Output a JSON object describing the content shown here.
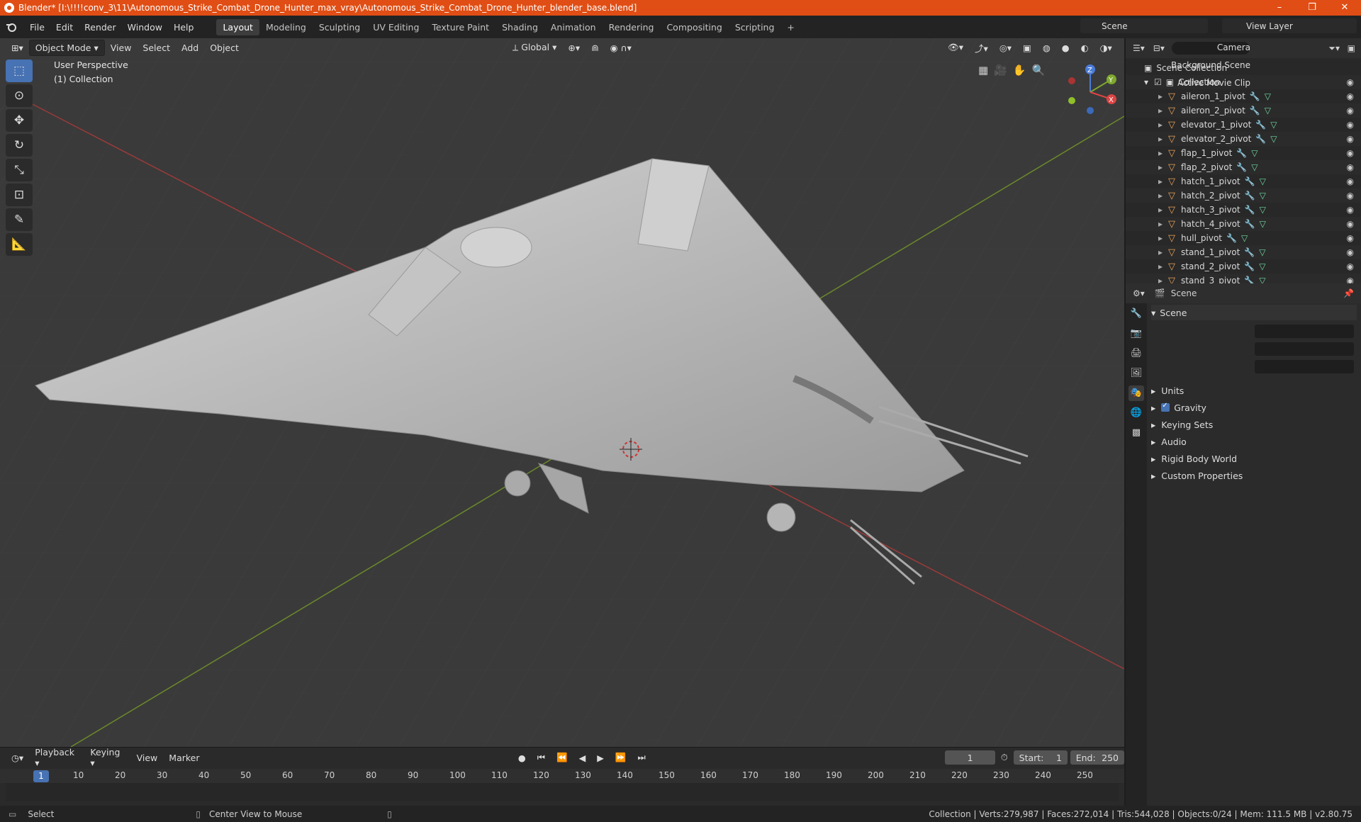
{
  "window": {
    "title": "Blender* [I:\\!!!!conv_3\\11\\Autonomous_Strike_Combat_Drone_Hunter_max_vray\\Autonomous_Strike_Combat_Drone_Hunter_blender_base.blend]",
    "controls": [
      "–",
      "❐",
      "✕"
    ]
  },
  "menubar": {
    "menus": [
      "File",
      "Edit",
      "Render",
      "Window",
      "Help"
    ],
    "workspaces": [
      "Layout",
      "Modeling",
      "Sculpting",
      "UV Editing",
      "Texture Paint",
      "Shading",
      "Animation",
      "Rendering",
      "Compositing",
      "Scripting"
    ],
    "active_workspace": "Layout",
    "add_tab": "+",
    "scene": "Scene",
    "view_layer": "View Layer"
  },
  "viewport": {
    "mode": "Object Mode",
    "menus": [
      "View",
      "Select",
      "Add",
      "Object"
    ],
    "orientation": "Global",
    "perspective": "User Perspective",
    "collection_label": "(1) Collection",
    "gizmo_axes": [
      "X",
      "Y",
      "Z"
    ]
  },
  "timeline": {
    "menus": [
      "Playback",
      "Keying",
      "View",
      "Marker"
    ],
    "current_frame": "1",
    "start_label": "Start:",
    "start": "1",
    "end_label": "End:",
    "end": "250",
    "ticks": [
      "10",
      "20",
      "30",
      "40",
      "50",
      "60",
      "70",
      "80",
      "90",
      "100",
      "110",
      "120",
      "130",
      "140",
      "150",
      "160",
      "170",
      "180",
      "190",
      "200",
      "210",
      "220",
      "230",
      "240",
      "250"
    ],
    "playhead": "1"
  },
  "statusbar": {
    "select": "Select",
    "center": "Center View to Mouse",
    "stats": "Collection | Verts:279,987 | Faces:272,014 | Tris:544,028 | Objects:0/24 | Mem: 111.5 MB | v2.80.75"
  },
  "outliner": {
    "root": "Scene Collection",
    "collection": "Collection",
    "items": [
      "aileron_1_pivot",
      "aileron_2_pivot",
      "elevator_1_pivot",
      "elevator_2_pivot",
      "flap_1_pivot",
      "flap_2_pivot",
      "hatch_1_pivot",
      "hatch_2_pivot",
      "hatch_3_pivot",
      "hatch_4_pivot",
      "hull_pivot",
      "stand_1_pivot",
      "stand_2_pivot",
      "stand_3_pivot"
    ]
  },
  "properties": {
    "context": "Scene",
    "panel": "Scene",
    "camera_label": "Camera",
    "bg_scene_label": "Background Scene",
    "movie_clip_label": "Active Movie Clip",
    "sections": [
      "Units",
      "Gravity",
      "Keying Sets",
      "Audio",
      "Rigid Body World",
      "Custom Properties"
    ],
    "gravity_checked": true
  }
}
